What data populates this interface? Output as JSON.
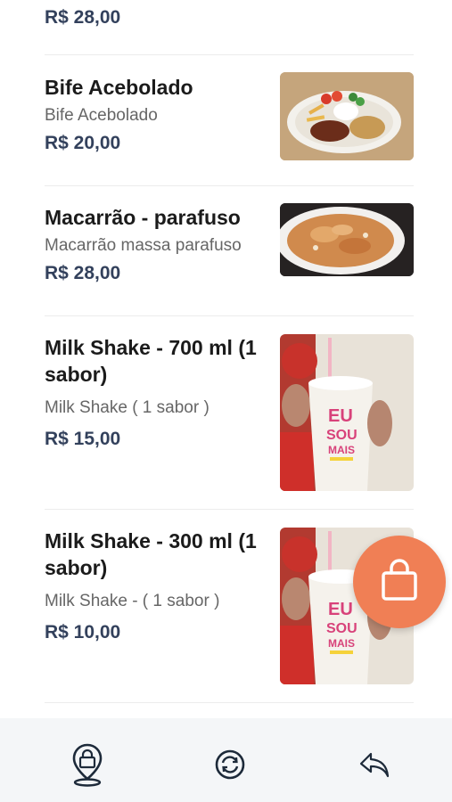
{
  "products": [
    {
      "price": "R$ 28,00"
    },
    {
      "name": "Bife Acebolado",
      "description": "Bife Acebolado",
      "price": "R$ 20,00",
      "image": "plate-steak-rice-fries-photo"
    },
    {
      "name": "Macarrão - parafuso",
      "description": "Macarrão massa parafuso",
      "price": "R$ 28,00",
      "image": "plate-fusilli-pasta-photo"
    },
    {
      "name_line1": "Milk Shake - 700 ml (1",
      "name_line2": "sabor)",
      "description": "Milk Shake ( 1 sabor )",
      "price": "R$ 15,00",
      "image": "milkshake-cup-photo"
    },
    {
      "name_line1": "Milk Shake - 300 ml (1",
      "name_line2": "sabor)",
      "description": "Milk Shake - ( 1 sabor )",
      "price": "R$ 10,00",
      "image": "milkshake-cup-photo"
    }
  ],
  "cup_text": {
    "l1": "EU",
    "l2": "SOU",
    "l3": "MAIS"
  },
  "cart_fab": {
    "icon": "shopping-bag-icon",
    "color": "#f07f55"
  },
  "bottom_nav": [
    {
      "icon": "store-location-icon"
    },
    {
      "icon": "refresh-icon"
    },
    {
      "icon": "back-arrow-icon"
    }
  ]
}
